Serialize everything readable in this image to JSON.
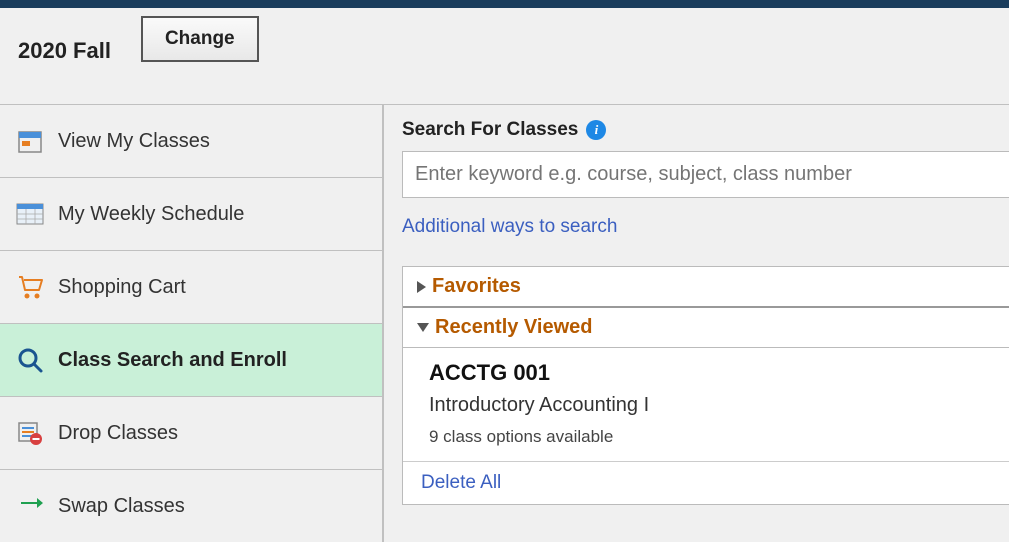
{
  "header": {
    "term": "2020 Fall",
    "change_label": "Change"
  },
  "sidebar": {
    "items": [
      {
        "label": "View My Classes",
        "icon": "calendar-icon"
      },
      {
        "label": "My Weekly Schedule",
        "icon": "schedule-icon"
      },
      {
        "label": "Shopping Cart",
        "icon": "cart-icon"
      },
      {
        "label": "Class Search and Enroll",
        "icon": "search-icon"
      },
      {
        "label": "Drop Classes",
        "icon": "drop-icon"
      },
      {
        "label": "Swap Classes",
        "icon": "swap-icon"
      }
    ]
  },
  "search": {
    "label": "Search For Classes",
    "placeholder": "Enter keyword e.g. course, subject, class number",
    "additional_link": "Additional ways to search"
  },
  "panels": {
    "favorites": {
      "title": "Favorites"
    },
    "recently_viewed": {
      "title": "Recently Viewed",
      "items": [
        {
          "code": "ACCTG 001",
          "title": "Introductory Accounting I",
          "options": "9 class options available"
        }
      ],
      "delete_all": "Delete All"
    }
  }
}
